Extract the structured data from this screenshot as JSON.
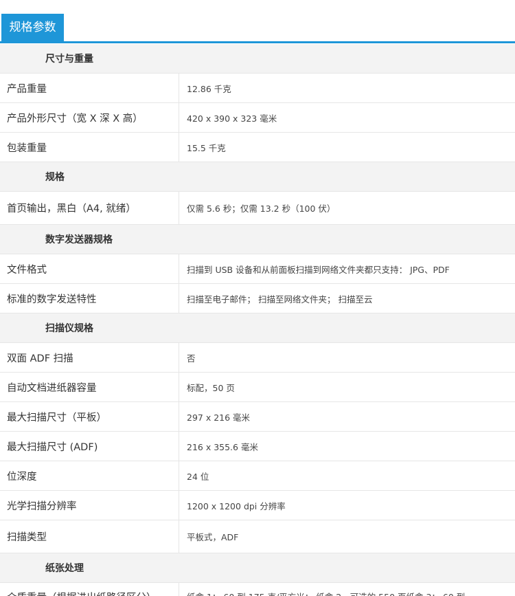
{
  "header": {
    "title": "规格参数"
  },
  "sections": [
    {
      "title": "尺寸与重量",
      "rows": [
        {
          "label": "产品重量",
          "value": "12.86 千克"
        },
        {
          "label": "产品外形尺寸（宽 X 深 X 高）",
          "value": "420 x 390 x 323 毫米"
        },
        {
          "label": "包装重量",
          "value": "15.5 千克"
        }
      ]
    },
    {
      "title": "规格",
      "rows": [
        {
          "label": "首页输出，黑白（A4, 就绪）",
          "value": "仅需 5.6 秒；仅需 13.2 秒（100 伏）"
        }
      ]
    },
    {
      "title": "数字发送器规格",
      "rows": [
        {
          "label": "文件格式",
          "value": "扫描到 USB 设备和从前面板扫描到网络文件夹都只支持： JPG、PDF"
        },
        {
          "label": "标准的数字发送特性",
          "value": "扫描至电子邮件； 扫描至网络文件夹； 扫描至云"
        }
      ]
    },
    {
      "title": "扫描仪规格",
      "rows": [
        {
          "label": "双面 ADF 扫描",
          "value": "否"
        },
        {
          "label": "自动文档进纸器容量",
          "value": "标配，50 页"
        },
        {
          "label": "最大扫描尺寸（平板）",
          "value": "297 x 216 毫米"
        },
        {
          "label": "最大扫描尺寸 (ADF)",
          "value": "216 x 355.6 毫米"
        },
        {
          "label": "位深度",
          "value": "24 位"
        },
        {
          "label": "光学扫描分辨率",
          "value": "1200 x 1200 dpi 分辨率"
        },
        {
          "label": "扫描类型",
          "value": "平板式，ADF"
        }
      ]
    },
    {
      "title": "纸张处理",
      "rows": [
        {
          "label": "介质重量（根据进出纸路径区分）",
          "value": "纸盒 1： 60 到 175 克/平方米； 纸盒 2、可选的 550 页纸盒 3： 60 到"
        }
      ]
    }
  ]
}
